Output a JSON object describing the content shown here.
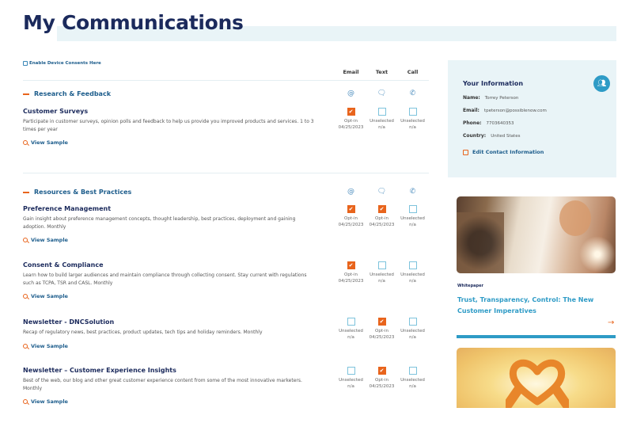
{
  "page": {
    "title": "My Communications",
    "enable_link": "Enable Device Consents Here"
  },
  "columns": [
    "Email",
    "Text",
    "Call"
  ],
  "channel_icons": [
    "at-icon",
    "chat-bubble-icon",
    "phone-icon"
  ],
  "sections": [
    {
      "label": "Research & Feedback",
      "items": [
        {
          "name": "Customer Surveys",
          "description": "Participate in customer surveys, opinion polls and feedback to help us provide you improved products and services. 1 to 3 times per year",
          "sample_label": "View Sample",
          "channels": [
            {
              "checked": true,
              "status": "Opt-in",
              "date": "04/25/2023"
            },
            {
              "checked": false,
              "status": "Unselected",
              "date": "n/a"
            },
            {
              "checked": false,
              "status": "Unselected",
              "date": "n/a"
            }
          ]
        }
      ]
    },
    {
      "label": "Resources & Best Practices",
      "items": [
        {
          "name": "Preference Management",
          "description": "Gain insight about preference management concepts, thought leadership, best practices, deployment and gaining adoption. Monthly",
          "sample_label": "View Sample",
          "channels": [
            {
              "checked": true,
              "status": "Opt-in",
              "date": "04/25/2023"
            },
            {
              "checked": true,
              "status": "Opt-in",
              "date": "04/25/2023"
            },
            {
              "checked": false,
              "status": "Unselected",
              "date": "n/a"
            }
          ]
        },
        {
          "name": "Consent & Compliance",
          "description": "Learn how to build larger audiences and maintain compliance through collecting consent. Stay current with regulations such as TCPA, TSR and CASL. Monthly",
          "sample_label": "View Sample",
          "channels": [
            {
              "checked": true,
              "status": "Opt-in",
              "date": "04/25/2023"
            },
            {
              "checked": false,
              "status": "Unselected",
              "date": "n/a"
            },
            {
              "checked": false,
              "status": "Unselected",
              "date": "n/a"
            }
          ]
        },
        {
          "name": "Newsletter - DNCSolution",
          "description": "Recap of regulatory news, best practices, product updates, tech tips and holiday reminders. Monthly",
          "sample_label": "View Sample",
          "channels": [
            {
              "checked": false,
              "status": "Unselected",
              "date": "n/a"
            },
            {
              "checked": true,
              "status": "Opt-in",
              "date": "04/25/2023"
            },
            {
              "checked": false,
              "status": "Unselected",
              "date": "n/a"
            }
          ]
        },
        {
          "name": "Newsletter – Customer Experience Insights",
          "description": "Best of the web, our blog and other great customer experience content from some of the most innovative marketers. Monthly",
          "sample_label": "View Sample",
          "channels": [
            {
              "checked": false,
              "status": "Unselected",
              "date": "n/a"
            },
            {
              "checked": true,
              "status": "Opt-in",
              "date": "04/25/2023"
            },
            {
              "checked": false,
              "status": "Unselected",
              "date": "n/a"
            }
          ]
        }
      ]
    }
  ],
  "info": {
    "title": "Your Information",
    "rows": [
      {
        "label": "Name:",
        "value": "Torrey Peterson"
      },
      {
        "label": "Email:",
        "value": "tpeterson@possiblenow.com"
      },
      {
        "label": "Phone:",
        "value": "7703640353"
      },
      {
        "label": "Country:",
        "value": "United States"
      }
    ],
    "edit_label": "Edit Contact Information"
  },
  "promo": {
    "tag": "Whitepaper",
    "title": "Trust, Transparency, Control: The New Customer Imperatives",
    "arrow": "→"
  },
  "colors": {
    "accent_orange": "#e8641c",
    "navy": "#1b2a5c",
    "link_blue": "#1d5d8c",
    "teal": "#2e9bc6",
    "panel_bg": "#e9f4f7"
  }
}
